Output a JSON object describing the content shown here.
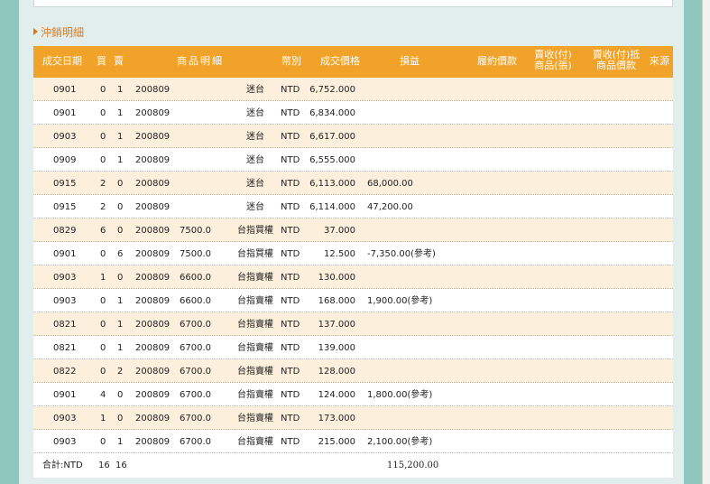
{
  "section": {
    "title": "沖銷明細"
  },
  "table": {
    "headers": {
      "date": "成交日期",
      "buy": "買",
      "sell": "賣",
      "item": "商品明細",
      "currency": "幣別",
      "price": "成交價格",
      "pl": "損益",
      "performance": "履約價款",
      "receive_line1": "賣收(付)",
      "receive_line2": "商品(張)",
      "offset_line1": "賣收(付)抵",
      "offset_line2": "商品價款",
      "source": "來源"
    },
    "rows": [
      {
        "date": "0901",
        "buy": "0",
        "sell": "1",
        "month": "200809",
        "strike": "",
        "product": "迷台",
        "currency": "NTD",
        "price": "6,752.000",
        "pl": ""
      },
      {
        "date": "0901",
        "buy": "0",
        "sell": "1",
        "month": "200809",
        "strike": "",
        "product": "迷台",
        "currency": "NTD",
        "price": "6,834.000",
        "pl": ""
      },
      {
        "date": "0903",
        "buy": "0",
        "sell": "1",
        "month": "200809",
        "strike": "",
        "product": "迷台",
        "currency": "NTD",
        "price": "6,617.000",
        "pl": ""
      },
      {
        "date": "0909",
        "buy": "0",
        "sell": "1",
        "month": "200809",
        "strike": "",
        "product": "迷台",
        "currency": "NTD",
        "price": "6,555.000",
        "pl": ""
      },
      {
        "date": "0915",
        "buy": "2",
        "sell": "0",
        "month": "200809",
        "strike": "",
        "product": "迷台",
        "currency": "NTD",
        "price": "6,113.000",
        "pl": "68,000.00"
      },
      {
        "date": "0915",
        "buy": "2",
        "sell": "0",
        "month": "200809",
        "strike": "",
        "product": "迷台",
        "currency": "NTD",
        "price": "6,114.000",
        "pl": "47,200.00"
      },
      {
        "date": "0829",
        "buy": "6",
        "sell": "0",
        "month": "200809",
        "strike": "7500.0",
        "product": "台指買權",
        "currency": "NTD",
        "price": "37.000",
        "pl": ""
      },
      {
        "date": "0901",
        "buy": "0",
        "sell": "6",
        "month": "200809",
        "strike": "7500.0",
        "product": "台指買權",
        "currency": "NTD",
        "price": "12.500",
        "pl": "-7,350.00(參考)"
      },
      {
        "date": "0903",
        "buy": "1",
        "sell": "0",
        "month": "200809",
        "strike": "6600.0",
        "product": "台指賣權",
        "currency": "NTD",
        "price": "130.000",
        "pl": ""
      },
      {
        "date": "0903",
        "buy": "0",
        "sell": "1",
        "month": "200809",
        "strike": "6600.0",
        "product": "台指賣權",
        "currency": "NTD",
        "price": "168.000",
        "pl": "1,900.00(參考)"
      },
      {
        "date": "0821",
        "buy": "0",
        "sell": "1",
        "month": "200809",
        "strike": "6700.0",
        "product": "台指賣權",
        "currency": "NTD",
        "price": "137.000",
        "pl": ""
      },
      {
        "date": "0821",
        "buy": "0",
        "sell": "1",
        "month": "200809",
        "strike": "6700.0",
        "product": "台指賣權",
        "currency": "NTD",
        "price": "139.000",
        "pl": ""
      },
      {
        "date": "0822",
        "buy": "0",
        "sell": "2",
        "month": "200809",
        "strike": "6700.0",
        "product": "台指賣權",
        "currency": "NTD",
        "price": "128.000",
        "pl": ""
      },
      {
        "date": "0901",
        "buy": "4",
        "sell": "0",
        "month": "200809",
        "strike": "6700.0",
        "product": "台指賣權",
        "currency": "NTD",
        "price": "124.000",
        "pl": "1,800.00(參考)"
      },
      {
        "date": "0903",
        "buy": "1",
        "sell": "0",
        "month": "200809",
        "strike": "6700.0",
        "product": "台指賣權",
        "currency": "NTD",
        "price": "173.000",
        "pl": ""
      },
      {
        "date": "0903",
        "buy": "0",
        "sell": "1",
        "month": "200809",
        "strike": "6700.0",
        "product": "台指賣權",
        "currency": "NTD",
        "price": "215.000",
        "pl": "2,100.00(參考)"
      }
    ],
    "total": {
      "label": "合計:NTD",
      "buy": "16",
      "sell": "16",
      "pl": "115,200.00"
    }
  },
  "colors": {
    "header_bg": "#f0a229",
    "odd_row_bg": "#fcf0dd",
    "panel_bg": "#e2eeec",
    "frame": "#8fc6bd",
    "title": "#e0781a"
  }
}
